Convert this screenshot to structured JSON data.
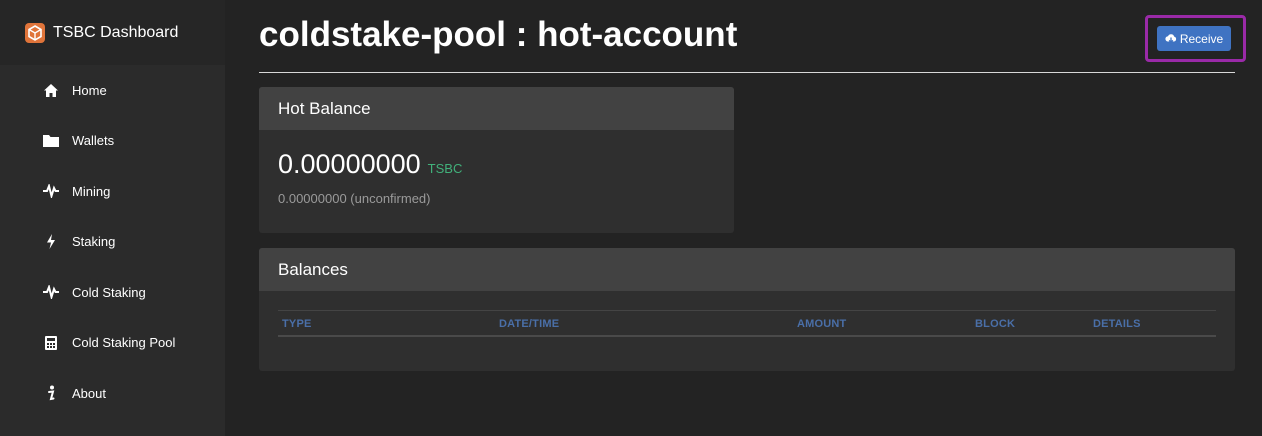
{
  "brand": {
    "title": "TSBC Dashboard"
  },
  "sidebar": {
    "items": [
      {
        "label": "Home",
        "icon": "home-icon"
      },
      {
        "label": "Wallets",
        "icon": "folder-icon"
      },
      {
        "label": "Mining",
        "icon": "pulse-icon"
      },
      {
        "label": "Staking",
        "icon": "bolt-icon"
      },
      {
        "label": "Cold Staking",
        "icon": "pulse-icon"
      },
      {
        "label": "Cold Staking Pool",
        "icon": "calculator-icon"
      },
      {
        "label": "About",
        "icon": "info-icon"
      }
    ]
  },
  "header": {
    "title": "coldstake-pool : hot-account",
    "receive_label": "Receive"
  },
  "hot_balance": {
    "title": "Hot Balance",
    "amount": "0.00000000",
    "unit": "TSBC",
    "unconfirmed": "0.00000000 (unconfirmed)"
  },
  "balances": {
    "title": "Balances",
    "columns": [
      "TYPE",
      "DATE/TIME",
      "AMOUNT",
      "BLOCK",
      "DETAILS"
    ],
    "rows": []
  },
  "colors": {
    "background": "#232323",
    "sidebar": "#2b2b2b",
    "accent_button": "#3f73c2",
    "highlight": "#9a2aa8",
    "unit_green": "#41b07a",
    "table_header": "#4a6fa8"
  }
}
